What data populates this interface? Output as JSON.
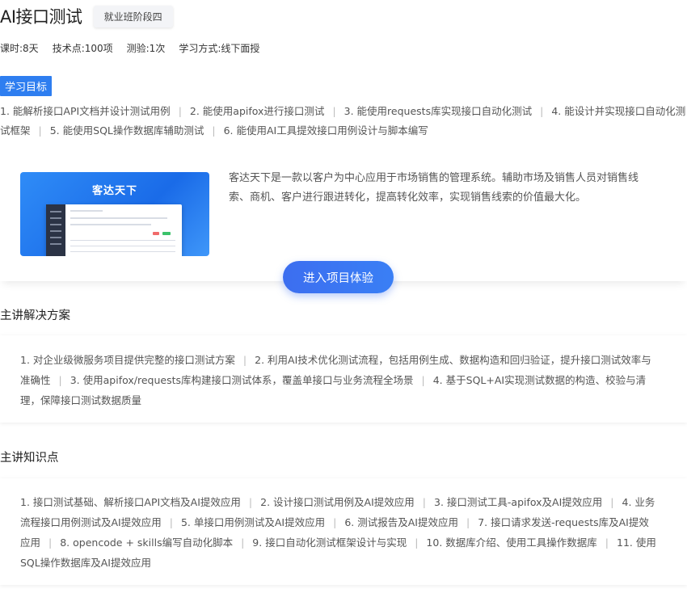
{
  "course": {
    "title": "AI接口测试",
    "stage_badge": "就业班阶段四",
    "meta": [
      "课时:8天",
      "技术点:100项",
      "测验:1次",
      "学习方式:线下面授"
    ]
  },
  "goals": {
    "tag": "学习目标",
    "items": [
      "1. 能解析接口API文档并设计测试用例",
      "2. 能使用apifox进行接口测试",
      "3. 能使用requests库实现接口自动化测试",
      "4. 能设计并实现接口自动化测试框架",
      "5. 能使用SQL操作数据库辅助测试",
      "6. 能使用AI工具提效接口用例设计与脚本编写"
    ]
  },
  "project": {
    "image_title": "客达天下",
    "description": "客达天下是一款以客户为中心应用于市场销售的管理系统。辅助市场及销售人员对销售线索、商机、客户进行跟进转化，提高转化效率，实现销售线索的价值最大化。",
    "button_label": "进入项目体验"
  },
  "solution": {
    "title": "主讲解决方案",
    "items": [
      "1. 对企业级微服务项目提供完整的接口测试方案",
      "2. 利用AI技术优化测试流程，包括用例生成、数据构造和回归验证，提升接口测试效率与准确性",
      "3. 使用apifox/requests库构建接口测试体系，覆盖单接口与业务流程全场景",
      "4. 基于SQL+AI实现测试数据的构造、校验与清理，保障接口测试数据质量"
    ]
  },
  "knowledge": {
    "title": "主讲知识点",
    "items": [
      "1. 接口测试基础、解析接口API文档及AI提效应用",
      "2. 设计接口测试用例及AI提效应用",
      "3. 接口测试工具-apifox及AI提效应用",
      "4. 业务流程接口用例测试及AI提效应用",
      "5. 单接口用例测试及AI提效应用",
      "6. 测试报告及AI提效应用",
      "7. 接口请求发送-requests库及AI提效应用",
      "8. opencode + skills编写自动化脚本",
      "9. 接口自动化测试框架设计与实现",
      "10. 数据库介绍、使用工具操作数据库",
      "11. 使用SQL操作数据库及AI提效应用"
    ]
  },
  "colors": {
    "accent": "#2e7ef0",
    "button": "#3c6ef0"
  }
}
